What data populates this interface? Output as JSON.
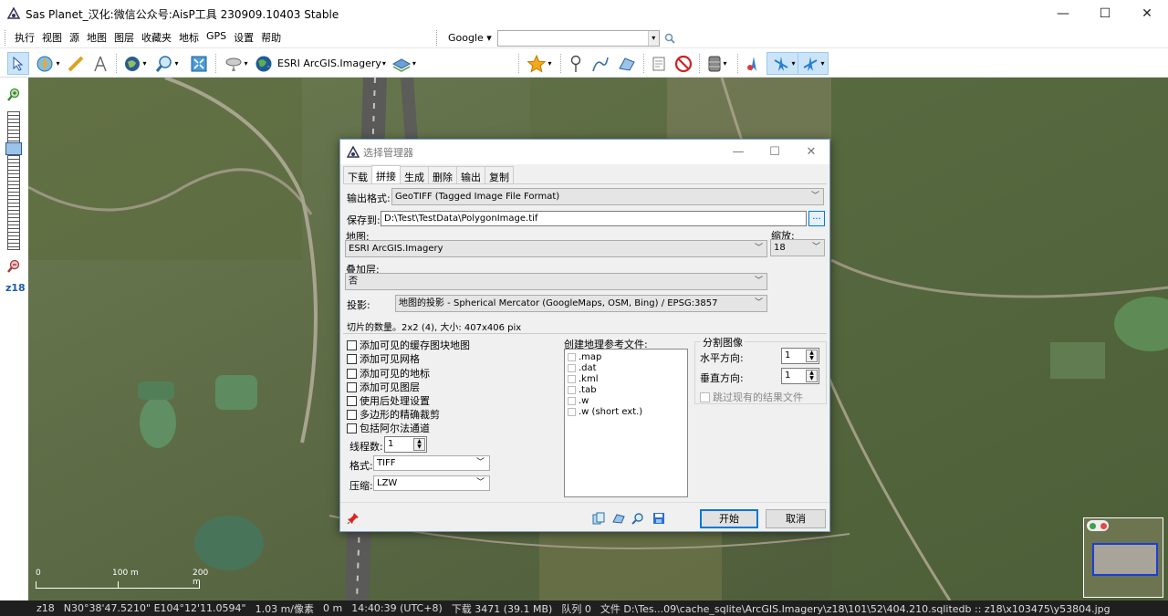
{
  "window": {
    "title": "Sas Planet_汉化:微信公众号:AisP工具 230909.10403 Stable",
    "minimize": "—",
    "maximize": "☐",
    "close": "✕"
  },
  "menu": [
    "执行",
    "视图",
    "源",
    "地图",
    "图层",
    "收藏夹",
    "地标",
    "GPS",
    "设置",
    "帮助"
  ],
  "search": {
    "engine": "Google ▾",
    "value": ""
  },
  "toolbar": {
    "map_label": "ESRI ArcGIS.Imagery"
  },
  "sidebar": {
    "zoom_level": "z18"
  },
  "map": {
    "scale": [
      "0",
      "100 m",
      "200 m"
    ]
  },
  "status": {
    "zoom": "z18",
    "coords": "N30°38'47.5210\" E104°12'11.0594\"",
    "resolution": "1.03 m/像素",
    "distance": "0 m",
    "time": "14:40:39 (UTC+8)",
    "download": "下载 3471 (39.1 MB)",
    "queue": "队列 0",
    "file": "文件 D:\\Tes...09\\cache_sqlite\\ArcGIS.Imagery\\z18\\101\\52\\404.210.sqlitedb :: z18\\x103475\\y53804.jpg"
  },
  "dialog": {
    "title": "选择管理器",
    "tabs": [
      "下载",
      "拼接",
      "生成",
      "删除",
      "输出",
      "复制"
    ],
    "active_tab": "拼接",
    "output_format_label": "输出格式:",
    "output_format": "GeoTIFF (Tagged Image File Format)",
    "save_to_label": "保存到:",
    "save_path": "D:\\Test\\TestData\\PolygonImage.tif",
    "browse": "...",
    "map_label": "地图:",
    "map_value": "ESRI ArcGIS.Imagery",
    "zoom_label": "缩放:",
    "zoom_value": "18",
    "overlay_label": "叠加层:",
    "overlay_value": "否",
    "projection_label": "投影:",
    "projection_value": "地图的投影 - Spherical Mercator (GoogleMaps, OSM, Bing) / EPSG:3857",
    "tile_info": "切片的数量。2x2 (4), 大小: 407x406 pix",
    "options": [
      "添加可见的缓存图块地图",
      "添加可见网格",
      "添加可见的地标",
      "添加可见图层",
      "使用后处理设置",
      "多边形的精确裁剪",
      "包括阿尔法通道"
    ],
    "threads_label": "线程数:",
    "threads_value": "1",
    "format_label": "格式:",
    "format_value": "TIFF",
    "compress_label": "压缩:",
    "compress_value": "LZW",
    "georef_label": "创建地理参考文件:",
    "georef_files": [
      ".map",
      ".dat",
      ".kml",
      ".tab",
      ".w",
      ".w (short ext.)"
    ],
    "split_label": "分割图像",
    "horizontal_label": "水平方向:",
    "horizontal_value": "1",
    "vertical_label": "垂直方向:",
    "vertical_value": "1",
    "skip_existing": "跳过现有的结果文件",
    "start": "开始",
    "cancel": "取消"
  },
  "colors": {
    "accent": "#0078d7",
    "dialog_bg": "#f0f0f0",
    "status_bg": "#1f1f1f"
  }
}
